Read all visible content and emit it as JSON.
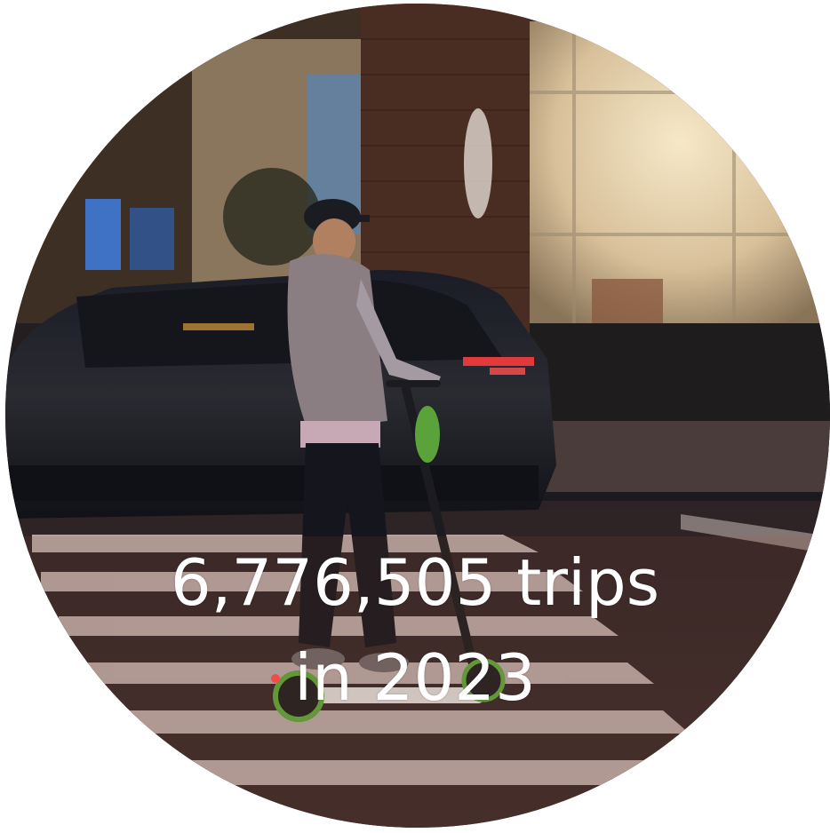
{
  "caption": {
    "line1": "6,776,505 trips",
    "line2": "in 2023"
  },
  "colors": {
    "background": "#ffffff",
    "caption_text": "#ffffff"
  },
  "photo": {
    "shape": "circle",
    "subject": "person riding an electric scooter across a crosswalk at night"
  }
}
